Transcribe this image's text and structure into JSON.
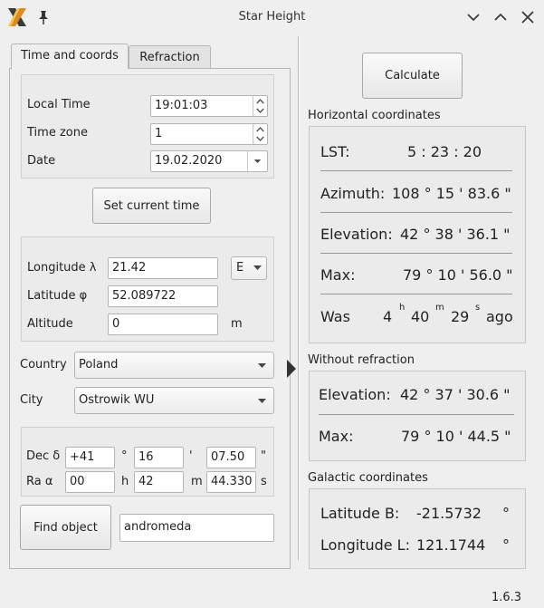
{
  "window": {
    "title": "Star Height",
    "version": "1.6.3"
  },
  "tabs": [
    "Time and coords",
    "Refraction"
  ],
  "time": {
    "local_time_label": "Local Time",
    "local_time_value": "19:01:03",
    "time_zone_label": "Time zone",
    "time_zone_value": "1",
    "date_label": "Date",
    "date_value": "19.02.2020",
    "set_current_time_label": "Set current time"
  },
  "location": {
    "longitude_label": "Longitude λ",
    "longitude_value": "21.42",
    "longitude_dir": "E",
    "latitude_label": "Latitude φ",
    "latitude_value": "52.089722",
    "altitude_label": "Altitude",
    "altitude_value": "0",
    "altitude_unit": "m",
    "country_label": "Country",
    "country_value": "Poland",
    "city_label": "City",
    "city_value": "Ostrowik WU"
  },
  "object": {
    "dec_label": "Dec δ",
    "dec_deg": "+41",
    "dec_deg_unit": "°",
    "dec_min": "16",
    "dec_min_unit": "'",
    "dec_sec": "07.50",
    "dec_sec_unit": "\"",
    "ra_label": "Ra α",
    "ra_h": "00",
    "ra_h_unit": "h",
    "ra_m": "42",
    "ra_m_unit": "m",
    "ra_s": "44.330",
    "ra_s_unit": "s",
    "find_object_label": "Find object",
    "search_value": "andromeda"
  },
  "results": {
    "calculate_label": "Calculate",
    "horizontal_title": "Horizontal coordinates",
    "lst_label": "LST:",
    "lst_value": "5  : 23 : 20",
    "azimuth_label": "Azimuth:",
    "azimuth_value": "108 ° 15 ' 83.6 \"",
    "elevation_label": "Elevation:",
    "elevation_value": "42 ° 38 ' 36.1 \"",
    "max_label": "Max:",
    "max_value": "79 ° 10 ' 56.0 \"",
    "was_label": "Was",
    "was_h": "4",
    "was_h_unit": "h",
    "was_m": "40",
    "was_m_unit": "m",
    "was_s": "29",
    "was_s_unit": "s",
    "was_suffix": "ago",
    "norefr_title": "Without refraction",
    "norefr_elevation_label": "Elevation:",
    "norefr_elevation_value": "42 ° 37 ' 30.6 \"",
    "norefr_max_label": "Max:",
    "norefr_max_value": "79 ° 10 ' 44.5 \"",
    "galactic_title": "Galactic coordinates",
    "gal_lat_label": "Latitude B:",
    "gal_lat_value": "-21.5732",
    "gal_lat_unit": "°",
    "gal_lon_label": "Longitude L:",
    "gal_lon_value": "121.1744",
    "gal_lon_unit": "°"
  }
}
